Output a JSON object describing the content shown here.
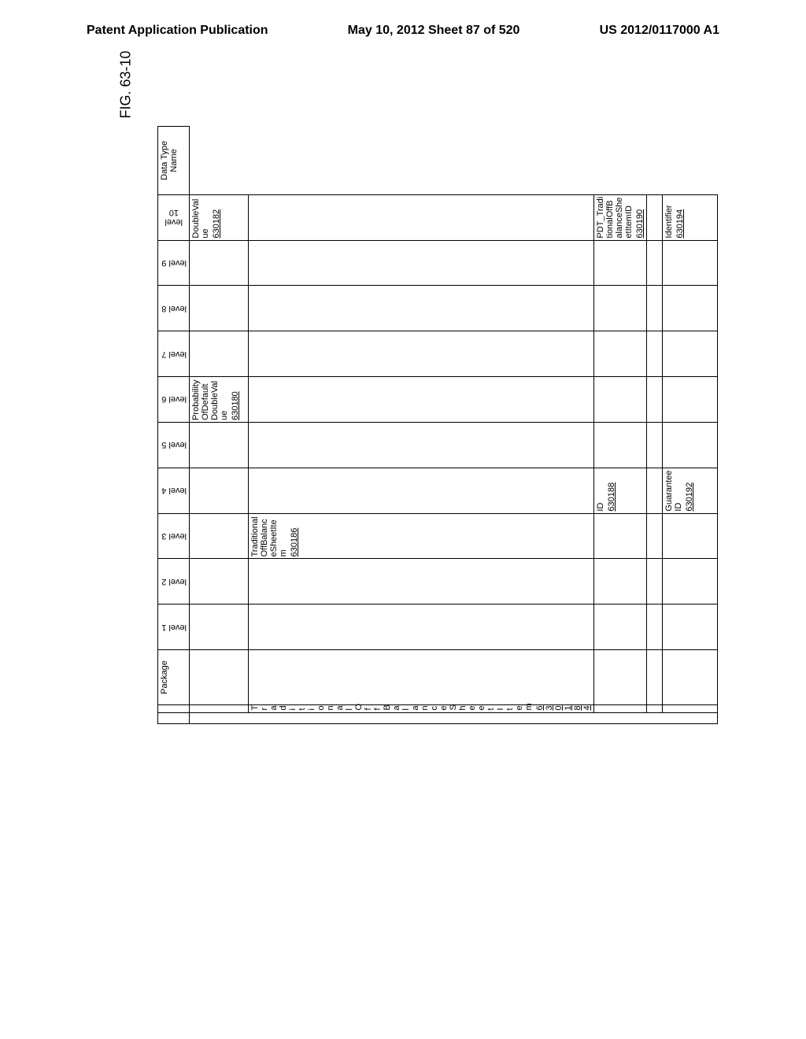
{
  "header": {
    "left": "Patent Application Publication",
    "center": "May 10, 2012  Sheet 87 of 520",
    "right": "US 2012/0117000 A1"
  },
  "figure_label": "FIG. 63-10",
  "columns": {
    "package": "Package",
    "level1": "level 1",
    "level2": "level 2",
    "level3": "level 3",
    "level4": "level 4",
    "level5": "level 5",
    "level6": "level 6",
    "level7": "level 7",
    "level8": "level 8",
    "level9": "level 9",
    "level10": "level 10",
    "datatype": "Data Type Name"
  },
  "rows": [
    {
      "level7": "ProbabilityOfDefaultDoubleValue",
      "level7_ref": "630180",
      "datatype": "DoubleValue",
      "datatype_ref": "630182"
    },
    {
      "package": "TraditionalOffBalanceSheetItem",
      "package_ref": "630184",
      "level4": "TraditionalOffBalanceSheetItem",
      "level4_ref": "630186"
    },
    {
      "level5": "ID",
      "level5_ref": "630188",
      "datatype": "PDT_TraditionalOffBalanceSheetItemID",
      "datatype_ref": "630190"
    },
    {},
    {
      "level5": "GuaranteeID",
      "level5_ref": "630192",
      "datatype": "Identifier",
      "datatype_ref": "630194"
    }
  ],
  "chart_data": {
    "type": "table",
    "title": "FIG. 63-10",
    "columns": [
      "Package",
      "level 1",
      "level 2",
      "level 3",
      "level 4",
      "level 5",
      "level 6",
      "level 7",
      "level 8",
      "level 9",
      "level 10",
      "Data Type Name"
    ],
    "rows": [
      {
        "Package": "",
        "level 7": "ProbabilityOfDefaultDoubleValue (630180)",
        "Data Type Name": "DoubleValue (630182)"
      },
      {
        "Package": "TraditionalOffBalanceSheetItem (630184)",
        "level 4": "TraditionalOffBalanceSheetItem (630186)"
      },
      {
        "level 5": "ID (630188)",
        "Data Type Name": "PDT_TraditionalOffBalanceSheetItemID (630190)"
      },
      {},
      {
        "level 5": "GuaranteeID (630192)",
        "Data Type Name": "Identifier (630194)"
      }
    ]
  }
}
